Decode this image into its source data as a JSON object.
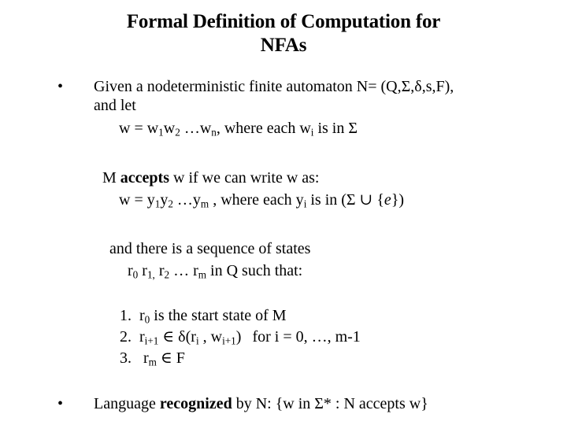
{
  "slide": {
    "title_line1": "Formal Definition of Computation for",
    "title_line2": "NFAs",
    "bullet_glyph": "•"
  },
  "bullet1": {
    "line1_prefix": "Given a nodeterministic finite automaton N= (Q,",
    "sigma": "Σ",
    "delta": "δ",
    "line1_suffix": ",s,F),",
    "line2": "and let",
    "w_def": {
      "lead": "w = w",
      "sub1": "1",
      "mid": "w",
      "sub2": "2",
      "dots": " …w",
      "subn": "n",
      "tail": ", where each w",
      "subi": "i",
      "end": " is in Σ"
    }
  },
  "accepts_block": {
    "line1_a": "M ",
    "line1_b": "accepts",
    "line1_c": " w if we can write w as:",
    "y_def": {
      "lead": "w = y",
      "sub1": "1",
      "mid": "y",
      "sub2": "2",
      "dots": " …y",
      "subm": "m",
      "tail": " , where each y",
      "subi": "i",
      "end": " is in (Σ ∪ {",
      "epsilon": "e",
      "close": "})"
    }
  },
  "sequence_block": {
    "line1": "and there is a sequence of states",
    "states": {
      "r": "r",
      "sub0": "0",
      "r1": " r",
      "sub1": "1,",
      "r2": " r",
      "sub2": "2",
      "dots": " … r",
      "subm": "m",
      "tail": " in Q  such that:"
    }
  },
  "conditions": {
    "item1": {
      "number": "1.",
      "text_a": "r",
      "sub": "0",
      "text_b": " is the start state of M"
    },
    "item2": {
      "number": "2.",
      "text_a": "r",
      "sub_a": "i+1",
      "text_b": " ∈ δ(r",
      "sub_b": "i",
      "text_c": " , w",
      "sub_c": "i+1",
      "text_d": ")",
      "text_e": "for i = 0, …, m-1"
    },
    "item3": {
      "number": "3.",
      "text_a": " r",
      "sub": "m",
      "text_b": " ∈ F"
    }
  },
  "bullet2": {
    "text_a": "Language ",
    "text_b": "recognized",
    "text_c": " by N: {w in Σ* : N accepts w}"
  }
}
